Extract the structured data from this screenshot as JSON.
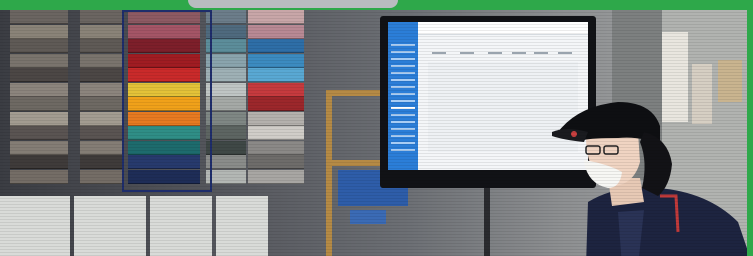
{
  "scene": {
    "description_label": "",
    "border_color": "#2ea84a",
    "swatch_colors_rack1": [
      "#6b6561",
      "#8a8378",
      "#5f5a56",
      "#7a746d",
      "#4c4745",
      "#8c857d",
      "#6e6963",
      "#a39c91",
      "#5a5452",
      "#847d75",
      "#3f3b3a",
      "#746d66"
    ],
    "swatch_colors_rack2": [
      "#8d5a63",
      "#a45566",
      "#7d1f2a",
      "#a01c22",
      "#c92a2a",
      "#e3c238",
      "#f0a11a",
      "#e77a21",
      "#2f8e86",
      "#1d6b6d",
      "#273a6d",
      "#1e2d57"
    ],
    "swatch_colors_rack3": [
      "#6c7d8a",
      "#4f6a7e",
      "#5c8d9a",
      "#8aa4ad",
      "#9eb0b5",
      "#bfc5c4",
      "#a5a9a6",
      "#7f8784",
      "#5d6562",
      "#3f4846",
      "#8a8c8a",
      "#b3b7b4"
    ],
    "swatch_colors_rack4": [
      "#c8a6a8",
      "#b88994",
      "#2e6ea7",
      "#3c8bc0",
      "#59a8d3",
      "#c63a3e",
      "#9c272b",
      "#b4b1ad",
      "#d0cdc8",
      "#8b8987",
      "#6e6c6a",
      "#a8a6a3"
    ],
    "icons": [
      "monitor-icon",
      "person-icon"
    ]
  }
}
